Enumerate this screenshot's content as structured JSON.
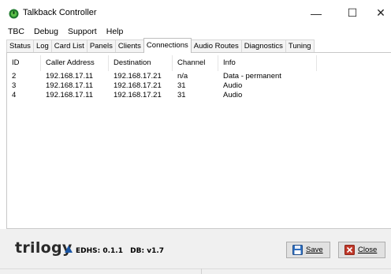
{
  "window": {
    "title": "Talkback Controller",
    "minimize_glyph": "—",
    "maximize_glyph": "☐",
    "close_glyph": "✕",
    "icon": "green-circle-app-icon"
  },
  "menu": [
    "TBC",
    "Debug",
    "Support",
    "Help"
  ],
  "tabs": [
    {
      "label": "Status",
      "active": false
    },
    {
      "label": "Log",
      "active": false
    },
    {
      "label": "Card List",
      "active": false
    },
    {
      "label": "Panels",
      "active": false
    },
    {
      "label": "Clients",
      "active": false
    },
    {
      "label": "Connections",
      "active": true
    },
    {
      "label": "Audio Routes",
      "active": false
    },
    {
      "label": "Diagnostics",
      "active": false
    },
    {
      "label": "Tuning",
      "active": false
    }
  ],
  "connections": {
    "columns": [
      "ID",
      "Caller Address",
      "Destination",
      "Channel",
      "Info"
    ],
    "rows": [
      {
        "id": "2",
        "caller": "192.168.17.11",
        "destination": "192.168.17.21",
        "channel": "n/a",
        "info": "Data - permanent"
      },
      {
        "id": "3",
        "caller": "192.168.17.11",
        "destination": "192.168.17.21",
        "channel": "31",
        "info": "Audio"
      },
      {
        "id": "4",
        "caller": "192.168.17.11",
        "destination": "192.168.17.21",
        "channel": "31",
        "info": "Audio"
      }
    ]
  },
  "footer": {
    "logo_text": "trilogy",
    "edhs": "EDHS: 0.1.1",
    "db": "DB: v1.7",
    "save_label": "Save",
    "close_label": "Close",
    "colors": {
      "logo_triangle": "#1a56a6",
      "save_icon": "#2f6fc0",
      "close_icon": "#c0392b"
    }
  }
}
